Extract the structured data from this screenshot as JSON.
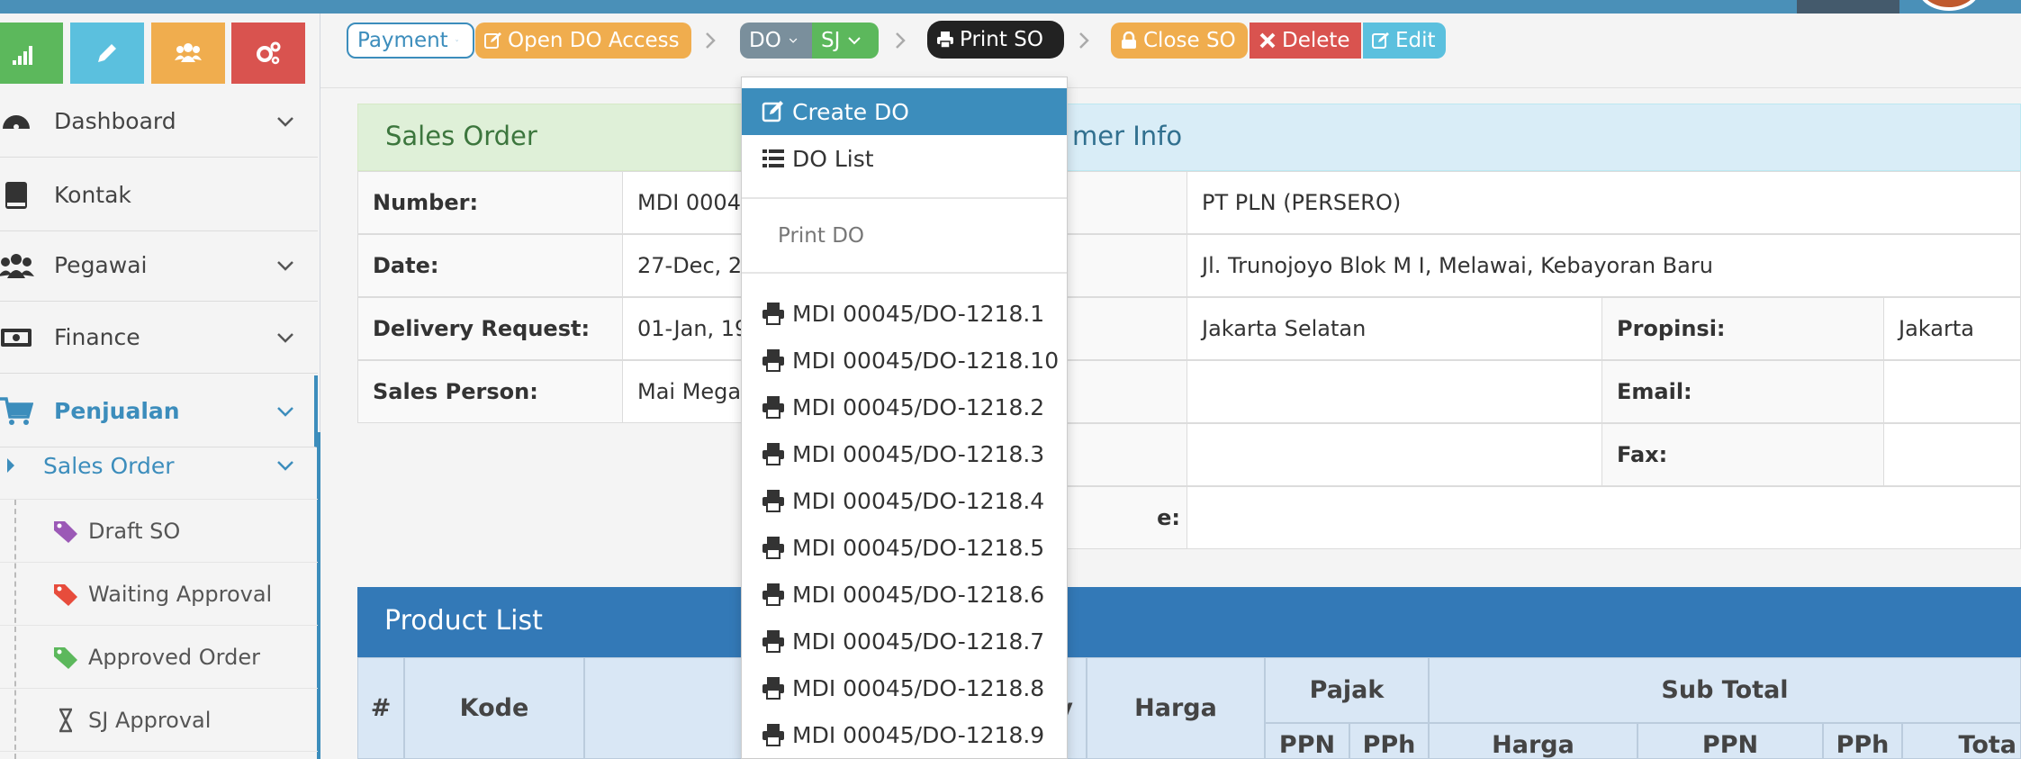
{
  "toolbar": {
    "payment_label": "Payment",
    "open_do_label": "Open DO Access",
    "do_label": "DO",
    "sj_label": "SJ",
    "print_so_label": "Print SO",
    "close_so_label": "Close SO",
    "delete_label": "Delete",
    "edit_label": "Edit"
  },
  "sidebar": {
    "items": [
      {
        "label": "Dashboard",
        "icon": "dashboard-icon"
      },
      {
        "label": "Kontak",
        "icon": "book-icon"
      },
      {
        "label": "Pegawai",
        "icon": "users-icon"
      },
      {
        "label": "Finance",
        "icon": "money-icon"
      },
      {
        "label": "Penjualan",
        "icon": "cart-icon"
      }
    ],
    "submenu_title": "Sales Order",
    "sub_items": [
      {
        "label": "Draft SO"
      },
      {
        "label": "Waiting Approval"
      },
      {
        "label": "Approved Order"
      },
      {
        "label": "SJ Approval"
      }
    ]
  },
  "sales_order": {
    "title": "Sales Order",
    "rows": [
      {
        "label": "Number:",
        "value": "MDI 0004"
      },
      {
        "label": "Date:",
        "value": "27-Dec, 2"
      },
      {
        "label": "Delivery Request:",
        "value": "01-Jan, 19"
      },
      {
        "label": "Sales Person:",
        "value": "Mai Mega"
      }
    ]
  },
  "customer_info": {
    "title": "mer Info",
    "company": "PT PLN (PERSERO)",
    "address": "Jl. Trunojoyo Blok M I, Melawai, Kebayoran Baru",
    "city": "Jakarta Selatan",
    "propinsi_label": "Propinsi:",
    "propinsi_value": "Jakarta",
    "email_label": "Email:",
    "fax_label": "Fax:",
    "partial_label": "e:"
  },
  "product_list": {
    "title": "Product List",
    "headers": {
      "num": "#",
      "kode": "Kode",
      "qty_partial": "y",
      "harga": "Harga",
      "pajak": "Pajak",
      "subtotal": "Sub Total",
      "ppn": "PPN",
      "pph": "PPh",
      "sub_harga": "Harga",
      "sub_ppn": "PPN",
      "sub_pph": "PPh",
      "total_partial": "Tota"
    }
  },
  "dropdown": {
    "create_do": "Create DO",
    "do_list": "DO List",
    "print_do_header": "Print DO",
    "do_items": [
      "MDI 00045/DO-1218.1",
      "MDI 00045/DO-1218.10",
      "MDI 00045/DO-1218.2",
      "MDI 00045/DO-1218.3",
      "MDI 00045/DO-1218.4",
      "MDI 00045/DO-1218.5",
      "MDI 00045/DO-1218.6",
      "MDI 00045/DO-1218.7",
      "MDI 00045/DO-1218.8",
      "MDI 00045/DO-1218.9"
    ]
  },
  "colors": {
    "primary": "#3c8dbc",
    "success": "#5cb85c",
    "warning": "#f0ad4e",
    "danger": "#d9534f",
    "info": "#5bc0de"
  }
}
